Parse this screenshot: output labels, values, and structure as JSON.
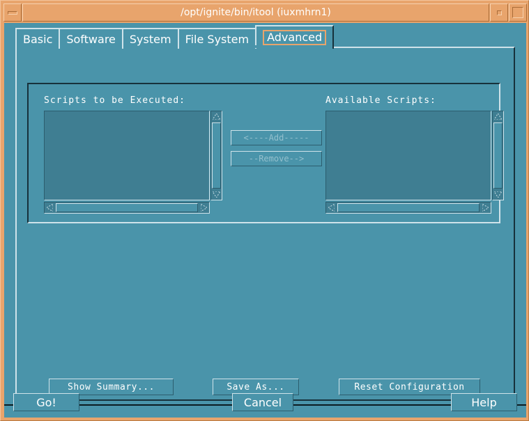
{
  "window": {
    "title": "/opt/ignite/bin/itool (iuxmhrn1)",
    "minimize_icon": "minimize-icon",
    "restore_icon": "restore-icon",
    "maximize_icon": "maximize-icon"
  },
  "colors": {
    "title_bar": "#e8a46c",
    "window_frame": "#e8a46c",
    "background": "#4a94aa",
    "list_background": "#3f7e92",
    "selected_tab_highlight": "#e8a46c",
    "text": "#ffffff",
    "shadow_dark": "#17313b",
    "shadow_light": "#cfe3ea"
  },
  "tabs": [
    {
      "label": "Basic",
      "selected": false
    },
    {
      "label": "Software",
      "selected": false
    },
    {
      "label": "System",
      "selected": false
    },
    {
      "label": "File System",
      "selected": false
    },
    {
      "label": "Advanced",
      "selected": true
    }
  ],
  "advanced_panel": {
    "scripts_to_be_executed": {
      "label": "Scripts to be Executed:",
      "items": [],
      "vertical_scrollbar": {
        "up_arrow": "scroll-up-arrow-icon",
        "down_arrow": "scroll-down-arrow-icon"
      },
      "horizontal_scrollbar": {
        "left_arrow": "scroll-left-arrow-icon",
        "right_arrow": "scroll-right-arrow-icon"
      }
    },
    "available_scripts": {
      "label": "Available Scripts:",
      "items": [],
      "vertical_scrollbar": {
        "up_arrow": "scroll-up-arrow-icon",
        "down_arrow": "scroll-down-arrow-icon"
      },
      "horizontal_scrollbar": {
        "left_arrow": "scroll-left-arrow-icon",
        "right_arrow": "scroll-right-arrow-icon"
      }
    },
    "transfer_buttons": {
      "add": {
        "label": "<----Add-----",
        "enabled": false
      },
      "remove": {
        "label": "--Remove-->",
        "enabled": false
      }
    }
  },
  "action_buttons": {
    "show_summary": "Show Summary...",
    "save_as": "Save As...",
    "reset_configuration": "Reset Configuration"
  },
  "bottom_buttons": {
    "go": "Go!",
    "cancel": "Cancel",
    "help": "Help"
  }
}
